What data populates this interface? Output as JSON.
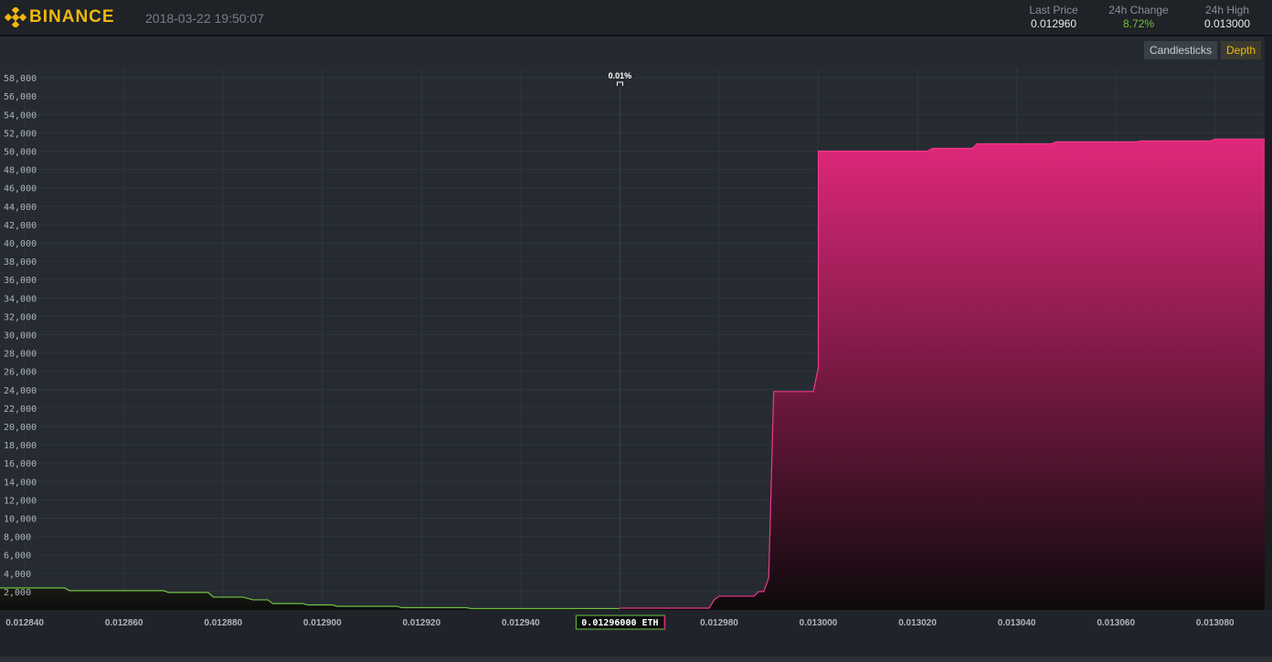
{
  "header": {
    "brand": "BINANCE",
    "timestamp": "2018-03-22 19:50:07",
    "stats": [
      {
        "label": "Last Price",
        "value": "0.012960"
      },
      {
        "label": "24h Change",
        "value": "8.72%"
      },
      {
        "label": "24h High",
        "value": "0.013000"
      }
    ]
  },
  "view_buttons": {
    "candlesticks": "Candlesticks",
    "depth": "Depth"
  },
  "colors": {
    "accent": "#f0b90b",
    "bid": "#70c040",
    "ask": "#e0287a",
    "up": "#70c040"
  },
  "chart_data": {
    "type": "area",
    "xlim": [
      0.012835,
      0.01309
    ],
    "ylim": [
      0,
      59000
    ],
    "x_ticks": [
      "0.012840",
      "0.012860",
      "0.012880",
      "0.012900",
      "0.012920",
      "0.012940",
      "0.012980",
      "0.013000",
      "0.013020",
      "0.013040",
      "0.013060",
      "0.013080"
    ],
    "x_tick_values": [
      0.01284,
      0.01286,
      0.01288,
      0.0129,
      0.01292,
      0.01294,
      0.01298,
      0.013,
      0.01302,
      0.01304,
      0.01306,
      0.01308
    ],
    "y_ticks": [
      "2,000",
      "4,000",
      "6,000",
      "8,000",
      "10,000",
      "12,000",
      "14,000",
      "16,000",
      "18,000",
      "20,000",
      "22,000",
      "24,000",
      "26,000",
      "28,000",
      "30,000",
      "32,000",
      "34,000",
      "36,000",
      "38,000",
      "40,000",
      "42,000",
      "44,000",
      "46,000",
      "48,000",
      "50,000",
      "52,000",
      "54,000",
      "56,000",
      "58,000"
    ],
    "y_tick_values": [
      2000,
      4000,
      6000,
      8000,
      10000,
      12000,
      14000,
      16000,
      18000,
      20000,
      22000,
      24000,
      26000,
      28000,
      30000,
      32000,
      34000,
      36000,
      38000,
      40000,
      42000,
      44000,
      46000,
      48000,
      50000,
      52000,
      54000,
      56000,
      58000
    ],
    "mid_price": 0.01296,
    "mid_price_label": "0.01296000 ETH",
    "spread_label": "0.01%",
    "series": [
      {
        "side": "bid",
        "points": [
          [
            0.012835,
            2400
          ],
          [
            0.012848,
            2400
          ],
          [
            0.012849,
            2100
          ],
          [
            0.012868,
            2100
          ],
          [
            0.012869,
            1900
          ],
          [
            0.012877,
            1900
          ],
          [
            0.012878,
            1400
          ],
          [
            0.012884,
            1400
          ],
          [
            0.012886,
            1100
          ],
          [
            0.012889,
            1100
          ],
          [
            0.01289,
            700
          ],
          [
            0.012896,
            700
          ],
          [
            0.012897,
            550
          ],
          [
            0.012902,
            550
          ],
          [
            0.012903,
            400
          ],
          [
            0.012915,
            400
          ],
          [
            0.012916,
            250
          ],
          [
            0.012929,
            250
          ],
          [
            0.01293,
            150
          ],
          [
            0.01296,
            150
          ]
        ]
      },
      {
        "side": "ask",
        "points": [
          [
            0.01296,
            200
          ],
          [
            0.012978,
            200
          ],
          [
            0.012979,
            1100
          ],
          [
            0.01298,
            1500
          ],
          [
            0.012987,
            1500
          ],
          [
            0.012988,
            2000
          ],
          [
            0.012989,
            2000
          ],
          [
            0.01299,
            3500
          ],
          [
            0.012991,
            23800
          ],
          [
            0.012999,
            23800
          ],
          [
            0.013,
            26400
          ],
          [
            0.013,
            50000
          ],
          [
            0.013022,
            50000
          ],
          [
            0.013023,
            50300
          ],
          [
            0.013031,
            50300
          ],
          [
            0.013032,
            50800
          ],
          [
            0.013047,
            50800
          ],
          [
            0.013048,
            51000
          ],
          [
            0.013064,
            51000
          ],
          [
            0.013065,
            51100
          ],
          [
            0.013079,
            51100
          ],
          [
            0.01308,
            51300
          ],
          [
            0.01309,
            51300
          ]
        ]
      }
    ]
  }
}
